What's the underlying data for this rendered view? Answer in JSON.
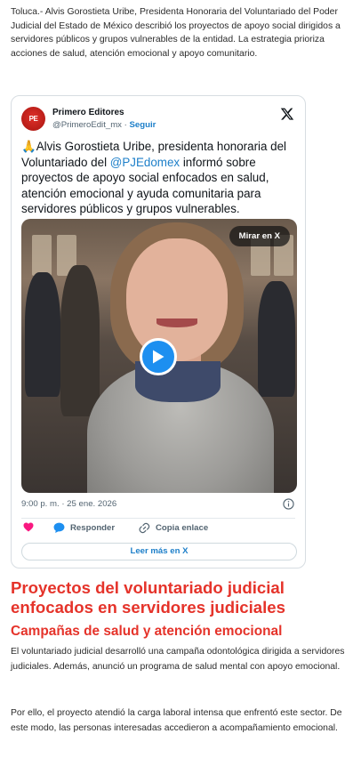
{
  "article": {
    "lead": "Toluca.- Alvis Gorostieta Uribe, Presidenta Honoraria del Voluntariado del Poder Judicial del Estado de México describió los proyectos de apoyo social dirigidos a servidores públicos y grupos vulnerables de la entidad. La estrategia prioriza acciones de salud, atención emocional y apoyo comunitario.",
    "heading_2": "Proyectos del voluntariado judicial enfocados en servidores judiciales",
    "heading_3": "Campañas de salud y atención emocional",
    "paragraph_1": "El voluntariado judicial desarrolló una campaña odontológica dirigida a servidores judiciales. Además, anunció un programa de salud mental con apoyo emocional.",
    "paragraph_2": "Por ello, el proyecto atendió la carga laboral intensa que enfrentó este sector. De este modo, las personas interesadas accedieron a acompañamiento emocional."
  },
  "tweet": {
    "author_name": "Primero Editores",
    "avatar_text": "PE",
    "handle": "@PrimeroEdit_mx",
    "separator": " · ",
    "follow_label": "Seguir",
    "text_emoji": "🙏",
    "text_part1": "Alvis Gorostieta Uribe, presidenta honoraria del Voluntariado del ",
    "mention": "@PJEdomex",
    "text_part2": " informó sobre proyectos de apoyo social enfocados en salud, atención emocional y ayuda comunitaria para servidores públicos y grupos vulnerables.",
    "watch_label": "Mirar en X",
    "timestamp": "9:00 p. m. · 25 ene. 2026",
    "reply_label": "Responder",
    "copy_link_label": "Copia enlace",
    "read_more_label": "Leer más en X",
    "icons": [
      "x-logo-icon",
      "play-icon",
      "info-icon",
      "heart-icon",
      "reply-icon",
      "link-icon"
    ],
    "colors": {
      "accent": "#1d7fc9",
      "like": "#f91880",
      "heading": "#e5332a"
    }
  }
}
